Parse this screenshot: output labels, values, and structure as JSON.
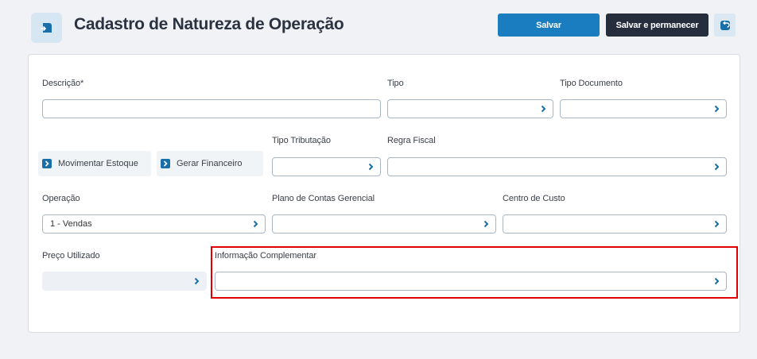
{
  "header": {
    "title": "Cadastro de Natureza de Operação",
    "save_label": "Salvar",
    "save_stay_label": "Salvar e permanecer"
  },
  "form": {
    "descricao": {
      "label": "Descrição*",
      "value": ""
    },
    "tipo": {
      "label": "Tipo",
      "value": ""
    },
    "tipo_documento": {
      "label": "Tipo Documento",
      "value": ""
    },
    "movimentar_estoque": {
      "label": "Movimentar Estoque"
    },
    "gerar_financeiro": {
      "label": "Gerar Financeiro"
    },
    "tipo_tributacao": {
      "label": "Tipo Tributação",
      "value": ""
    },
    "regra_fiscal": {
      "label": "Regra Fiscal",
      "value": ""
    },
    "operacao": {
      "label": "Operação",
      "value": "1 - Vendas"
    },
    "plano_contas": {
      "label": "Plano de Contas Gerencial",
      "value": ""
    },
    "centro_custo": {
      "label": "Centro de Custo",
      "value": ""
    },
    "preco_utilizado": {
      "label": "Preço Utilizado",
      "value": ""
    },
    "informacao_complementar": {
      "label": "Informação Complementar",
      "value": ""
    }
  },
  "icons": {
    "app": "document-export-icon",
    "back": "undo-icon",
    "dropdown": "chevron-right-icon"
  },
  "colors": {
    "primary": "#1a7dbf",
    "dark": "#262d3d",
    "highlight": "#e00000",
    "chevron": "#1a6fa8"
  }
}
